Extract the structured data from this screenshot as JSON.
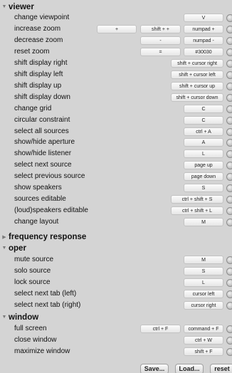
{
  "sections": {
    "viewer": {
      "label": "viewer",
      "expanded": true
    },
    "frequency": {
      "label": "frequency response",
      "expanded": false
    },
    "oper": {
      "label": "oper",
      "expanded": true
    },
    "window": {
      "label": "window",
      "expanded": true
    }
  },
  "viewer_rows": [
    {
      "label": "change viewpoint",
      "keys": [
        "",
        "",
        "V"
      ]
    },
    {
      "label": "increase zoom",
      "keys": [
        "+",
        "shift + +",
        "numpad +"
      ]
    },
    {
      "label": "decrease zoom",
      "keys": [
        "",
        "-",
        "numpad -"
      ]
    },
    {
      "label": "reset zoom",
      "keys": [
        "",
        "=",
        "#30030"
      ]
    },
    {
      "label": "shift display right",
      "keys": [
        "",
        "",
        "shift + cursor right"
      ]
    },
    {
      "label": "shift display left",
      "keys": [
        "",
        "",
        "shift + cursor left"
      ]
    },
    {
      "label": "shift display up",
      "keys": [
        "",
        "",
        "shift + cursor up"
      ]
    },
    {
      "label": "shift display down",
      "keys": [
        "",
        "",
        "shift + cursor down"
      ]
    },
    {
      "label": "change grid",
      "keys": [
        "",
        "",
        "C"
      ]
    },
    {
      "label": "circular constraint",
      "keys": [
        "",
        "",
        "C"
      ]
    },
    {
      "label": "select all sources",
      "keys": [
        "",
        "",
        "ctrl + A"
      ]
    },
    {
      "label": "show/hide aperture",
      "keys": [
        "",
        "",
        "A"
      ]
    },
    {
      "label": "show/hide listener",
      "keys": [
        "",
        "",
        "L"
      ]
    },
    {
      "label": "select next source",
      "keys": [
        "",
        "",
        "page up"
      ]
    },
    {
      "label": "select previous source",
      "keys": [
        "",
        "",
        "page down"
      ]
    },
    {
      "label": "show speakers",
      "keys": [
        "",
        "",
        "S"
      ]
    },
    {
      "label": "sources editable",
      "keys": [
        "",
        "",
        "ctrl + shift + S"
      ]
    },
    {
      "label": "(loud)speakers editable",
      "keys": [
        "",
        "",
        "ctrl + shift + L"
      ]
    },
    {
      "label": "change layout",
      "keys": [
        "",
        "",
        "M"
      ]
    }
  ],
  "oper_rows": [
    {
      "label": "mute source",
      "keys": [
        "",
        "",
        "M"
      ]
    },
    {
      "label": "solo source",
      "keys": [
        "",
        "",
        "S"
      ]
    },
    {
      "label": "lock source",
      "keys": [
        "",
        "",
        "L"
      ]
    },
    {
      "label": "select next tab (left)",
      "keys": [
        "",
        "",
        "cursor left"
      ]
    },
    {
      "label": "select next tab (right)",
      "keys": [
        "",
        "",
        "cursor right"
      ]
    }
  ],
  "window_rows": [
    {
      "label": "full screen",
      "keys": [
        "",
        "ctrl + F",
        "command + F"
      ]
    },
    {
      "label": "close window",
      "keys": [
        "",
        "",
        "ctrl + W"
      ]
    },
    {
      "label": "maximize window",
      "keys": [
        "",
        "",
        "shift + F"
      ]
    }
  ],
  "footer": {
    "save": "Save...",
    "load": "Load...",
    "reset": "reset"
  },
  "colors": {
    "background": "#d4d4d4",
    "button": "#f0f0f0"
  }
}
